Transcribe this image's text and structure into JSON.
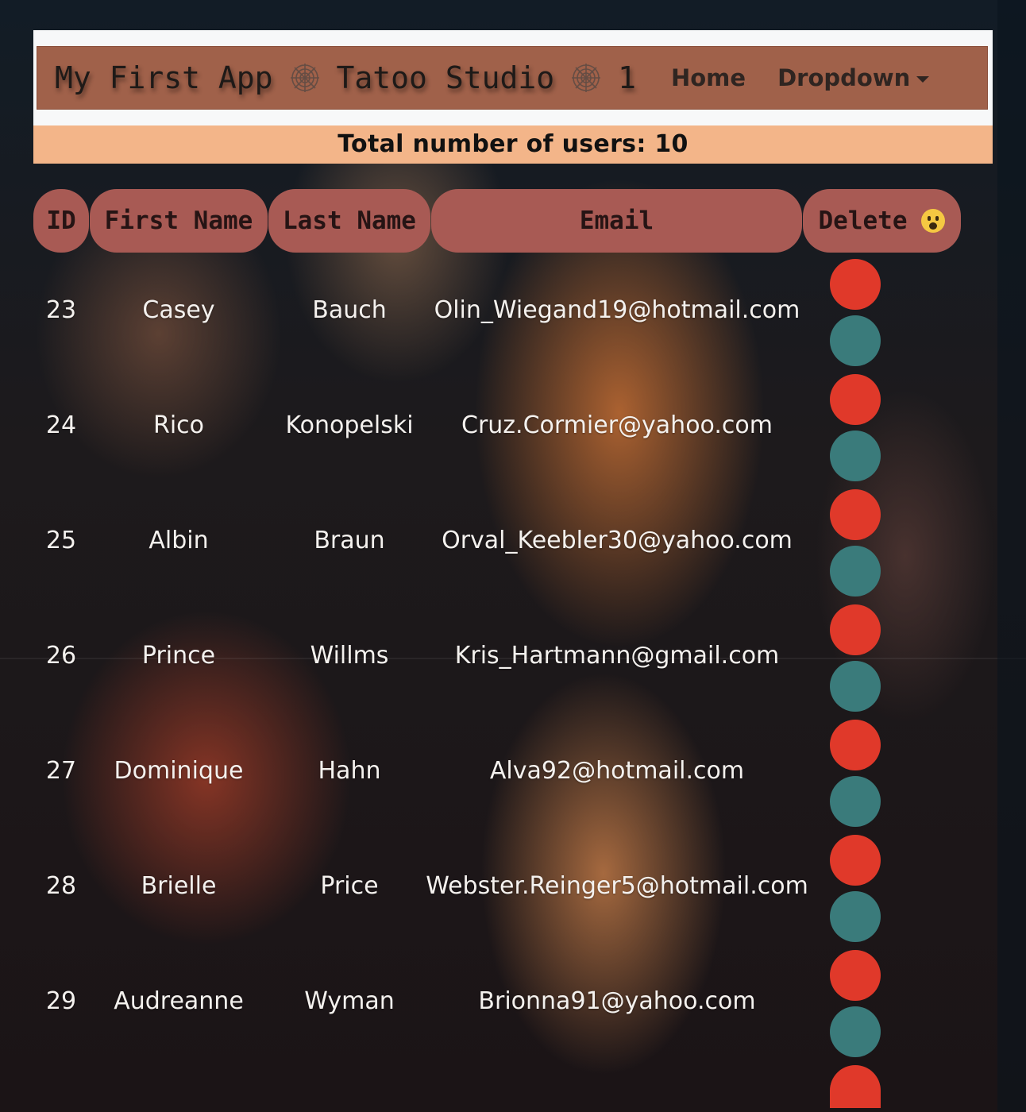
{
  "navbar": {
    "brand": [
      "My First App",
      "Tatoo Studio",
      "1"
    ],
    "links": [
      {
        "label": "Home"
      },
      {
        "label": "Dropdown"
      }
    ]
  },
  "summary": {
    "text": "Total number of users: 10"
  },
  "table": {
    "headers": {
      "id": "ID",
      "first_name": "First Name",
      "last_name": "Last Name",
      "email": "Email",
      "delete": "Delete"
    },
    "delete_header_icon": "scream-emoji-icon",
    "rows": [
      {
        "id": "23",
        "first": "Casey",
        "last": "Bauch",
        "email": "Olin_Wiegand19@hotmail.com"
      },
      {
        "id": "24",
        "first": "Rico",
        "last": "Konopelski",
        "email": "Cruz.Cormier@yahoo.com"
      },
      {
        "id": "25",
        "first": "Albin",
        "last": "Braun",
        "email": "Orval_Keebler30@yahoo.com"
      },
      {
        "id": "26",
        "first": "Prince",
        "last": "Willms",
        "email": "Kris_Hartmann@gmail.com"
      },
      {
        "id": "27",
        "first": "Dominique",
        "last": "Hahn",
        "email": "Alva92@hotmail.com"
      },
      {
        "id": "28",
        "first": "Brielle",
        "last": "Price",
        "email": "Webster.Reinger5@hotmail.com"
      },
      {
        "id": "29",
        "first": "Audreanne",
        "last": "Wyman",
        "email": "Brionna91@yahoo.com"
      }
    ],
    "action_colors": {
      "delete": "#e0392a",
      "edit": "#3a7b7b"
    }
  },
  "colors": {
    "navbar": "#a0614a",
    "banner": "#f3b589",
    "header_pill": "#a85a54"
  }
}
